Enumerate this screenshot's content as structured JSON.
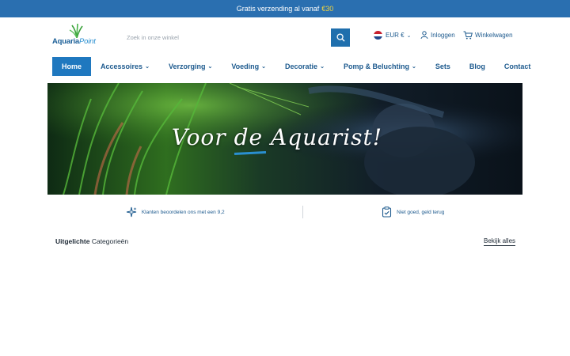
{
  "topbar": {
    "text": "Gratis verzending al vanaf",
    "amount": "€30"
  },
  "logo": {
    "name": "AquariaPoint",
    "part1": "Aquaria",
    "part2": "Point"
  },
  "search": {
    "placeholder": "Zoek in onze winkel"
  },
  "utility": {
    "currency": "EUR €",
    "login": "Inloggen",
    "cart": "Winkelwagen"
  },
  "nav": {
    "items": [
      {
        "label": "Home"
      },
      {
        "label": "Accessoires"
      },
      {
        "label": "Verzorging"
      },
      {
        "label": "Voeding"
      },
      {
        "label": "Decoratie"
      },
      {
        "label": "Pomp & Beluchting"
      },
      {
        "label": "Sets"
      },
      {
        "label": "Blog"
      },
      {
        "label": "Contact"
      }
    ]
  },
  "hero": {
    "title": "Voor de Aquarist!"
  },
  "usps": [
    {
      "text": "Klanten beoordelen ons met een 9,2",
      "icon": "sparkle-icon"
    },
    {
      "text": "Niet goed, geld terug",
      "icon": "clipboard-check-icon"
    }
  ],
  "featured": {
    "bold": "Uitgelichte",
    "rest": "Categorieën",
    "view_all": "Bekijk alles"
  },
  "colors": {
    "topbar": "#2a6fb0",
    "accent": "#1f78bf",
    "amount": "#f2d43d"
  }
}
